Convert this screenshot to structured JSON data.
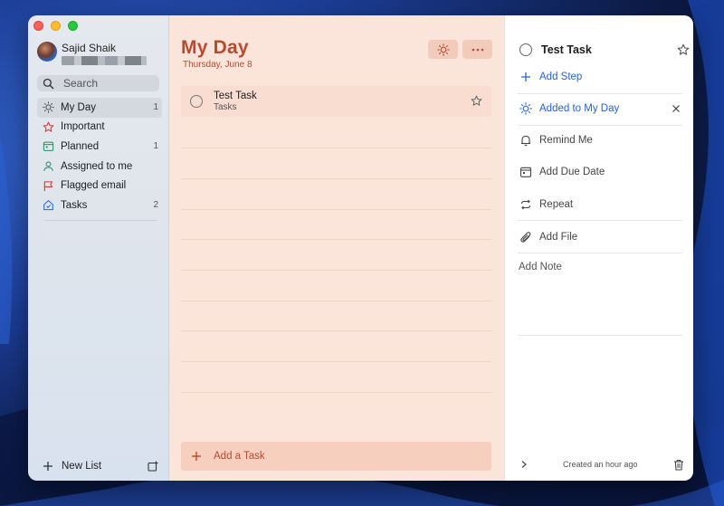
{
  "window": {
    "traffic_lights": [
      "close",
      "minimize",
      "zoom"
    ]
  },
  "sidebar": {
    "profile": {
      "name": "Sajid Shaik"
    },
    "search": {
      "placeholder": "Search"
    },
    "items": [
      {
        "label": "My Day",
        "count": "1",
        "icon": "sun-icon",
        "active": true
      },
      {
        "label": "Important",
        "count": "",
        "icon": "star-icon"
      },
      {
        "label": "Planned",
        "count": "1",
        "icon": "calendar-icon"
      },
      {
        "label": "Assigned to me",
        "count": "",
        "icon": "person-icon"
      },
      {
        "label": "Flagged email",
        "count": "",
        "icon": "flag-icon"
      },
      {
        "label": "Tasks",
        "count": "2",
        "icon": "home-icon"
      }
    ],
    "new_list_label": "New List"
  },
  "main": {
    "title": "My Day",
    "date": "Thursday, June 8",
    "tasks": [
      {
        "title": "Test Task",
        "list": "Tasks"
      }
    ],
    "add_task_label": "Add a Task"
  },
  "detail": {
    "task_title": "Test Task",
    "add_step_label": "Add Step",
    "my_day_label": "Added to My Day",
    "remind_label": "Remind Me",
    "due_label": "Add Due Date",
    "repeat_label": "Repeat",
    "file_label": "Add File",
    "note_placeholder": "Add Note",
    "created_text": "Created an hour ago"
  },
  "colors": {
    "accent": "#b94a2f",
    "link_blue": "#2564cf",
    "middle_bg": "#fbe5da"
  }
}
